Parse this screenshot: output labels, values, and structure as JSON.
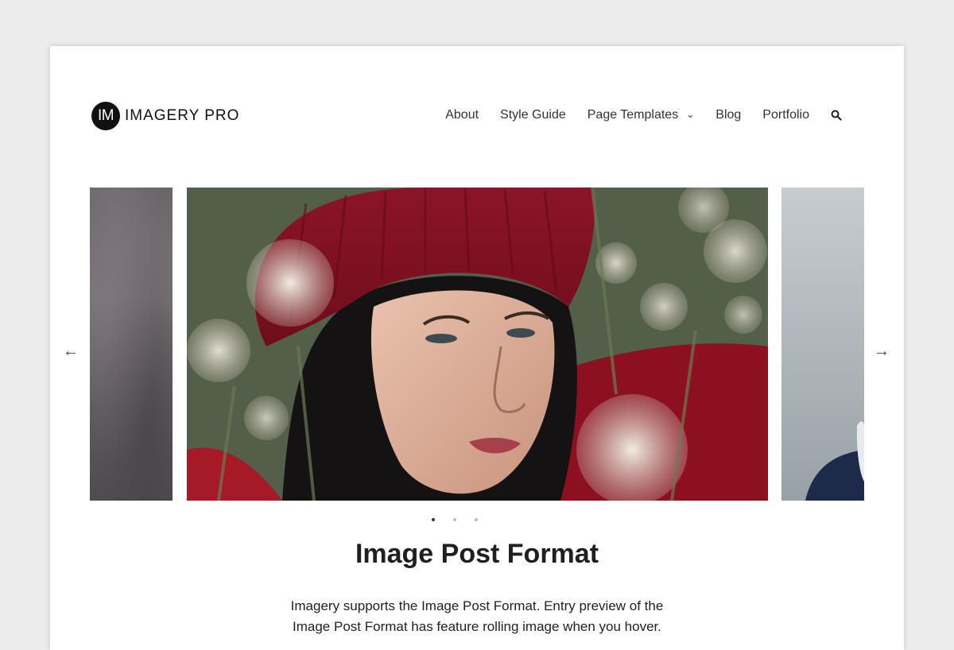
{
  "brand": {
    "badge": "IM",
    "name": "IMAGERY PRO"
  },
  "nav": {
    "items": [
      {
        "label": "About"
      },
      {
        "label": "Style Guide"
      },
      {
        "label": "Page Templates",
        "has_submenu": true
      },
      {
        "label": "Blog"
      },
      {
        "label": "Portfolio"
      }
    ],
    "icons": {
      "search": "search-icon",
      "submenu": "chevron-down-icon"
    }
  },
  "slider": {
    "prev_arrow": "←",
    "next_arrow": "→",
    "dots": 3,
    "active_dot": 1
  },
  "post": {
    "title": "Image Post Format",
    "excerpt": "Imagery supports the Image Post Format. Entry preview of the Image Post Format has feature rolling image when you hover."
  },
  "colors": {
    "page_background": "#ececec",
    "sheet_background": "#ffffff",
    "text": "#222222"
  }
}
